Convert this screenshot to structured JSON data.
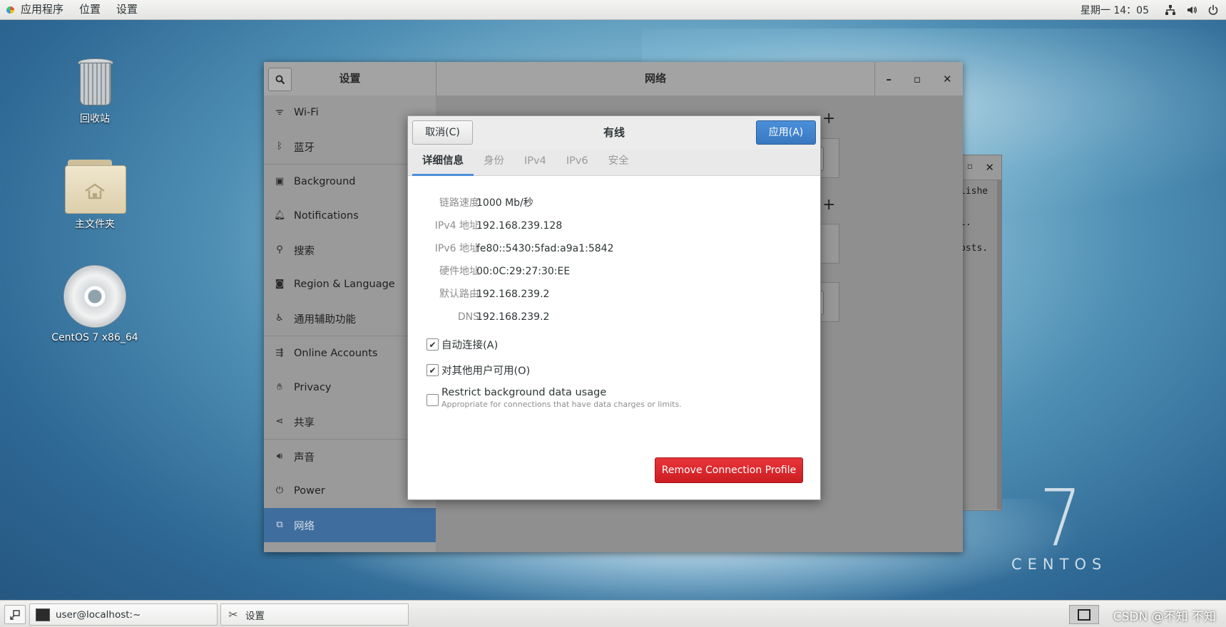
{
  "topbar": {
    "menu": [
      "应用程序",
      "位置",
      "设置"
    ],
    "clock": "星期一 14：05",
    "tray": [
      "network-icon",
      "volume-icon",
      "power-icon"
    ]
  },
  "desktop": {
    "icons": [
      {
        "label": "回收站",
        "icon": "trash-icon"
      },
      {
        "label": "主文件夹",
        "icon": "home-folder-icon"
      },
      {
        "label": "CentOS 7 x86_64",
        "icon": "disc-icon"
      }
    ],
    "watermark_number": "7",
    "watermark_text": "CENTOS"
  },
  "settings_window": {
    "left_title": "设置",
    "main_title": "网络",
    "controls": {
      "minimize": "–",
      "maximize": "▫",
      "close": "✕"
    },
    "sidebar": [
      {
        "label": "Wi-Fi",
        "icon": "wifi-icon"
      },
      {
        "label": "蓝牙",
        "icon": "bluetooth-icon"
      },
      {
        "label": "Background",
        "icon": "background-icon"
      },
      {
        "label": "Notifications",
        "icon": "bell-icon"
      },
      {
        "label": "搜索",
        "icon": "search-icon"
      },
      {
        "label": "Region & Language",
        "icon": "camera-icon"
      },
      {
        "label": "通用辅助功能",
        "icon": "accessibility-icon"
      },
      {
        "label": "Online Accounts",
        "icon": "online-accounts-icon"
      },
      {
        "label": "Privacy",
        "icon": "hand-icon"
      },
      {
        "label": "共享",
        "icon": "share-icon"
      },
      {
        "label": "声音",
        "icon": "speaker-icon"
      },
      {
        "label": "Power",
        "icon": "power-plug-icon"
      },
      {
        "label": "网络",
        "icon": "network-icon",
        "active": true
      }
    ]
  },
  "terminal_fragment": {
    "lines": [
      "lishe",
      "l.",
      "osts."
    ]
  },
  "dialog": {
    "cancel_label": "取消(C)",
    "title": "有线",
    "apply_label": "应用(A)",
    "tabs": [
      "详细信息",
      "身份",
      "IPv4",
      "IPv6",
      "安全"
    ],
    "active_tab": "详细信息",
    "details": [
      {
        "key": "链路速度",
        "value": "1000 Mb/秒"
      },
      {
        "key": "IPv4 地址",
        "value": "192.168.239.128"
      },
      {
        "key": "IPv6 地址",
        "value": "fe80::5430:5fad:a9a1:5842"
      },
      {
        "key": "硬件地址",
        "value": "00:0C:29:27:30:EE"
      },
      {
        "key": "默认路由",
        "value": "192.168.239.2"
      },
      {
        "key": "DNS",
        "value": "192.168.239.2"
      }
    ],
    "auto_connect": {
      "label": "自动连接(A)",
      "checked": true
    },
    "all_users": {
      "label": "对其他用户可用(O)",
      "checked": true
    },
    "restrict": {
      "label": "Restrict background data usage",
      "description": "Appropriate for connections that have data charges or limits.",
      "checked": false
    },
    "remove_label": "Remove Connection Profile"
  },
  "taskbar": {
    "tasks": [
      {
        "label": "user@localhost:~",
        "icon": "terminal-icon"
      },
      {
        "label": "设置",
        "icon": "tools-icon"
      }
    ],
    "watermark": "CSDN @不知 不知"
  },
  "colors": {
    "accent": "#4a90d9",
    "destructive": "#cc1d22",
    "sidebar_active": "#3f6d9e"
  }
}
